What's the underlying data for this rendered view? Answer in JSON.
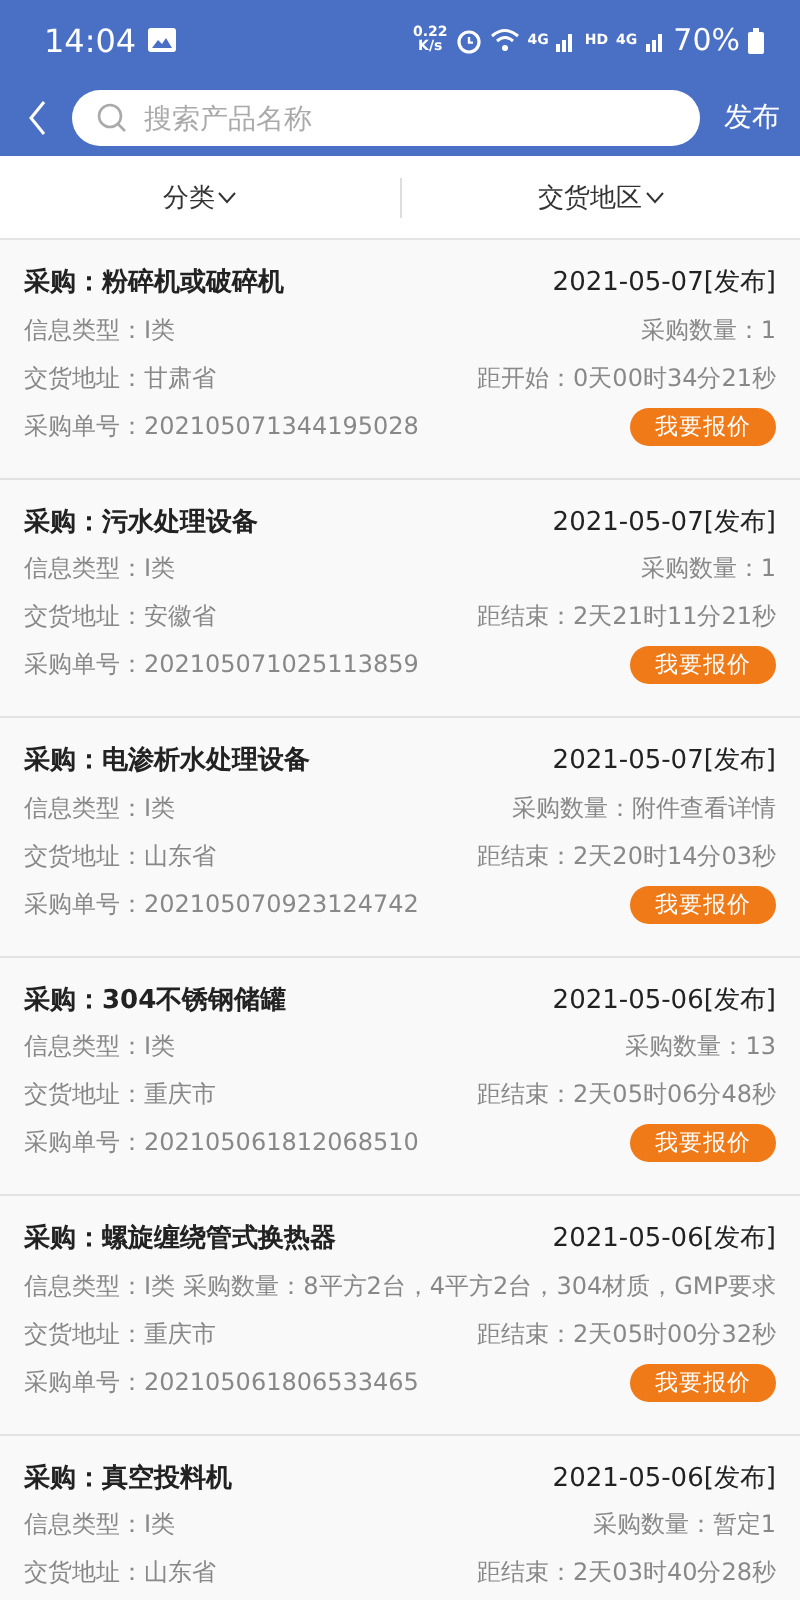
{
  "status_bar": {
    "time": "14:04",
    "network_speed": "0.22\nK/s",
    "network_type_1": "4G",
    "hd": "HD",
    "network_type_2": "4G",
    "battery": "70%"
  },
  "header": {
    "search": {
      "placeholder": "搜索产品名称"
    },
    "publish_button": "发布"
  },
  "filters": [
    {
      "label": "分类"
    },
    {
      "label": "交货地区"
    }
  ],
  "listings": [
    {
      "title": "采购：粉碎机或破碎机",
      "date": "2021-05-07[发布]",
      "type": "信息类型：I类",
      "quantity": "采购数量：1",
      "address": "交货地址：甘肃省",
      "countdown": "距开始：0天00时34分21秒",
      "order_no": "采购单号：202105071344195028",
      "button": "我要报价"
    },
    {
      "title": "采购：污水处理设备",
      "date": "2021-05-07[发布]",
      "type": "信息类型：I类",
      "quantity": "采购数量：1",
      "address": "交货地址：安徽省",
      "countdown": "距结束：2天21时11分21秒",
      "order_no": "采购单号：202105071025113859",
      "button": "我要报价"
    },
    {
      "title": "采购：电渗析水处理设备",
      "date": "2021-05-07[发布]",
      "type": "信息类型：I类",
      "quantity": "采购数量：附件查看详情",
      "address": "交货地址：山东省",
      "countdown": "距结束：2天20时14分03秒",
      "order_no": "采购单号：202105070923124742",
      "button": "我要报价"
    },
    {
      "title": "采购：304不锈钢储罐",
      "date": "2021-05-06[发布]",
      "type": "信息类型：I类",
      "quantity": "采购数量：13",
      "address": "交货地址：重庆市",
      "countdown": "距结束：2天05时06分48秒",
      "order_no": "采购单号：202105061812068510",
      "button": "我要报价"
    },
    {
      "title": "采购：螺旋缠绕管式换热器",
      "date": "2021-05-06[发布]",
      "type": "信息类型：I类",
      "quantity": "采购数量：8平方2台，4平方2台，304材质，GMP要求",
      "address": "交货地址：重庆市",
      "countdown": "距结束：2天05时00分32秒",
      "order_no": "采购单号：202105061806533465",
      "button": "我要报价"
    },
    {
      "title": "采购：真空投料机",
      "date": "2021-05-06[发布]",
      "type": "信息类型：I类",
      "quantity": "采购数量：暂定1",
      "address": "交货地址：山东省",
      "countdown": "距结束：2天03时40分28秒"
    }
  ]
}
